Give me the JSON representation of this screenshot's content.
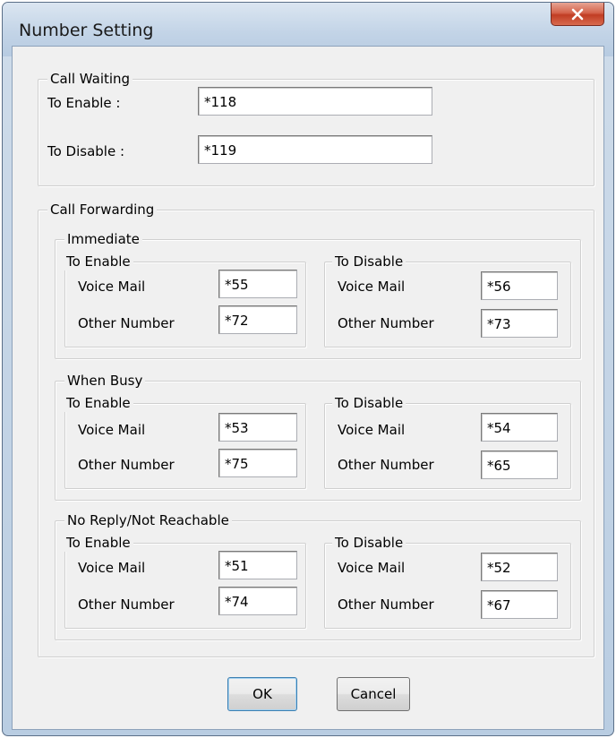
{
  "window": {
    "title": "Number Setting"
  },
  "call_waiting": {
    "legend": "Call Waiting",
    "enable_label": "To Enable :",
    "enable_value": "*118",
    "disable_label": "To Disable :",
    "disable_value": "*119"
  },
  "call_forwarding": {
    "legend": "Call Forwarding",
    "immediate": {
      "legend": "Immediate",
      "enable": {
        "legend": "To Enable",
        "voice_mail_label": "Voice Mail",
        "voice_mail": "*55",
        "other_label": "Other Number",
        "other": "*72"
      },
      "disable": {
        "legend": "To Disable",
        "voice_mail_label": "Voice Mail",
        "voice_mail": "*56",
        "other_label": "Other Number",
        "other": "*73"
      }
    },
    "busy": {
      "legend": "When Busy",
      "enable": {
        "legend": "To Enable",
        "voice_mail_label": "Voice Mail",
        "voice_mail": "*53",
        "other_label": "Other Number",
        "other": "*75"
      },
      "disable": {
        "legend": "To Disable",
        "voice_mail_label": "Voice Mail",
        "voice_mail": "*54",
        "other_label": "Other Number",
        "other": "*65"
      }
    },
    "no_reply": {
      "legend": "No Reply/Not Reachable",
      "enable": {
        "legend": "To Enable",
        "voice_mail_label": "Voice Mail",
        "voice_mail": "*51",
        "other_label": "Other Number",
        "other": "*74"
      },
      "disable": {
        "legend": "To Disable",
        "voice_mail_label": "Voice Mail",
        "voice_mail": "*52",
        "other_label": "Other Number",
        "other": "*67"
      }
    }
  },
  "buttons": {
    "ok": "OK",
    "cancel": "Cancel"
  }
}
